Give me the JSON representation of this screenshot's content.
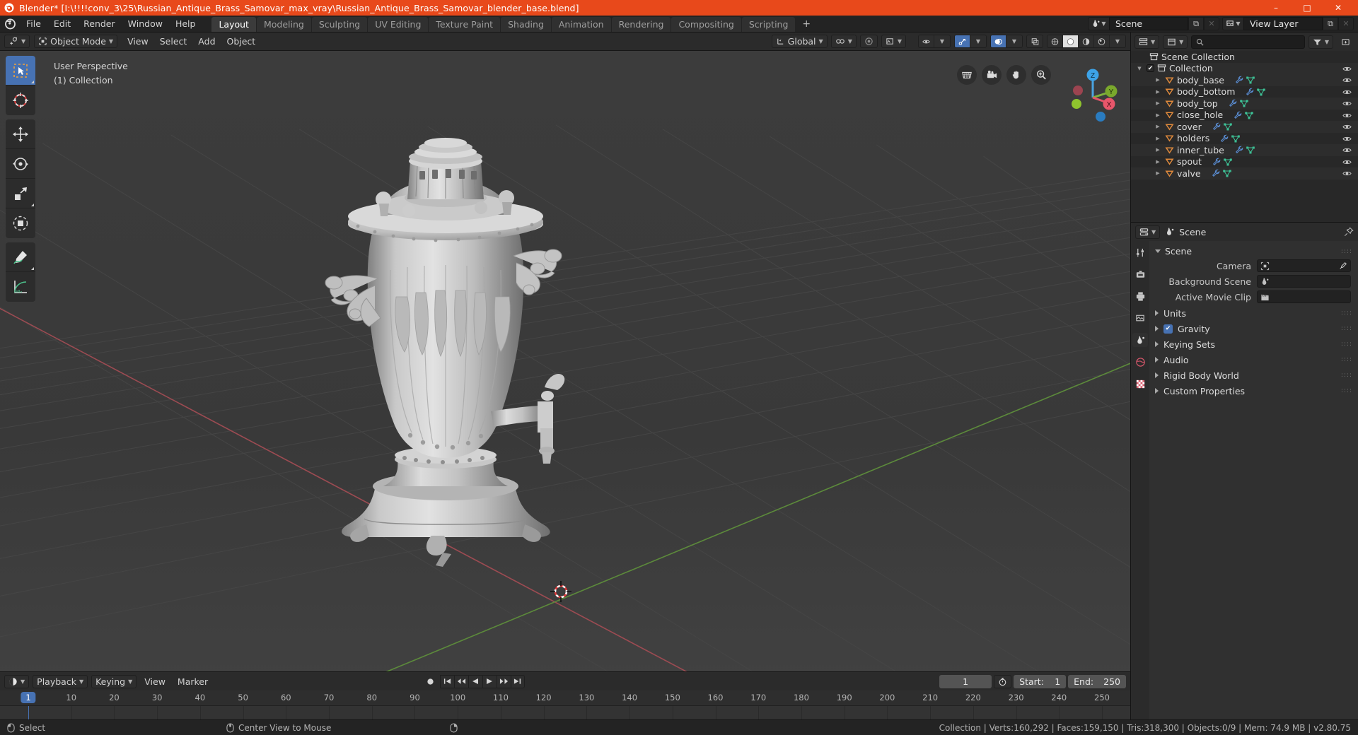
{
  "titlebar": {
    "text": "Blender* [I:\\!!!!conv_3\\25\\Russian_Antique_Brass_Samovar_max_vray\\Russian_Antique_Brass_Samovar_blender_base.blend]",
    "minimize": "–",
    "maximize": "□",
    "close": "✕",
    "accent": "#e8491b"
  },
  "topbar": {
    "menus": [
      "File",
      "Edit",
      "Render",
      "Window",
      "Help"
    ],
    "workspaces": [
      {
        "label": "Layout",
        "active": true
      },
      {
        "label": "Modeling",
        "active": false
      },
      {
        "label": "Sculpting",
        "active": false
      },
      {
        "label": "UV Editing",
        "active": false
      },
      {
        "label": "Texture Paint",
        "active": false
      },
      {
        "label": "Shading",
        "active": false
      },
      {
        "label": "Animation",
        "active": false
      },
      {
        "label": "Rendering",
        "active": false
      },
      {
        "label": "Compositing",
        "active": false
      },
      {
        "label": "Scripting",
        "active": false
      }
    ],
    "add_workspace": "+",
    "scene_name": "Scene",
    "view_layer_name": "View Layer",
    "new_btn": "⧉",
    "unlink_btn": "✕"
  },
  "viewport_header": {
    "mode": "Object Mode",
    "menus": [
      "View",
      "Select",
      "Add",
      "Object"
    ],
    "transform_orientation": "Global"
  },
  "viewport": {
    "perspective_label": "User Perspective",
    "collection_label": "(1) Collection",
    "gizmo_axes": [
      "X",
      "Y",
      "Z"
    ],
    "tools": [
      "tweak-select-box-tool",
      "cursor-tool",
      "move-tool",
      "rotate-tool",
      "scale-tool",
      "transform-tool",
      "annotate-tool",
      "measure-tool"
    ],
    "nav_buttons": [
      "zoom-region-icon",
      "camera-view-icon",
      "pan-view-icon",
      "zoom-view-icon"
    ]
  },
  "outliner": {
    "search_placeholder": "",
    "root": "Scene Collection",
    "collection": "Collection",
    "items": [
      {
        "name": "body_base"
      },
      {
        "name": "body_bottom"
      },
      {
        "name": "body_top"
      },
      {
        "name": "close_hole"
      },
      {
        "name": "cover"
      },
      {
        "name": "holders"
      },
      {
        "name": "inner_tube"
      },
      {
        "name": "spout"
      },
      {
        "name": "valve"
      }
    ]
  },
  "properties": {
    "breadcrumb": "Scene",
    "panel_title": "Scene",
    "rows": [
      {
        "label": "Camera",
        "value": ""
      },
      {
        "label": "Background Scene",
        "value": ""
      },
      {
        "label": "Active Movie Clip",
        "value": ""
      }
    ],
    "sections": [
      {
        "label": "Units",
        "checkbox": false
      },
      {
        "label": "Gravity",
        "checkbox": true
      },
      {
        "label": "Keying Sets",
        "checkbox": false
      },
      {
        "label": "Audio",
        "checkbox": false
      },
      {
        "label": "Rigid Body World",
        "checkbox": false
      },
      {
        "label": "Custom Properties",
        "checkbox": false
      }
    ],
    "grip": "::::"
  },
  "timeline": {
    "menus": [
      "Playback",
      "Keying",
      "View",
      "Marker"
    ],
    "current_frame": "1",
    "start_label": "Start:",
    "start_value": "1",
    "end_label": "End:",
    "end_value": "250",
    "ticks": [
      "1",
      "10",
      "20",
      "30",
      "40",
      "50",
      "60",
      "70",
      "80",
      "90",
      "100",
      "110",
      "120",
      "130",
      "140",
      "150",
      "160",
      "170",
      "180",
      "190",
      "200",
      "210",
      "220",
      "230",
      "240",
      "250"
    ],
    "playhead_frame": "1"
  },
  "statusbar": {
    "left_items": [
      {
        "icon": "mouse-left-icon",
        "label": "Select"
      },
      {
        "icon": "mouse-middle-icon",
        "label": "Center View to Mouse"
      },
      {
        "icon": "mouse-right-icon",
        "label": ""
      }
    ],
    "stats": "Collection | Verts:160,292 | Faces:159,150 | Tris:318,300 | Objects:0/9 | Mem: 74.9 MB | v2.80.75"
  }
}
